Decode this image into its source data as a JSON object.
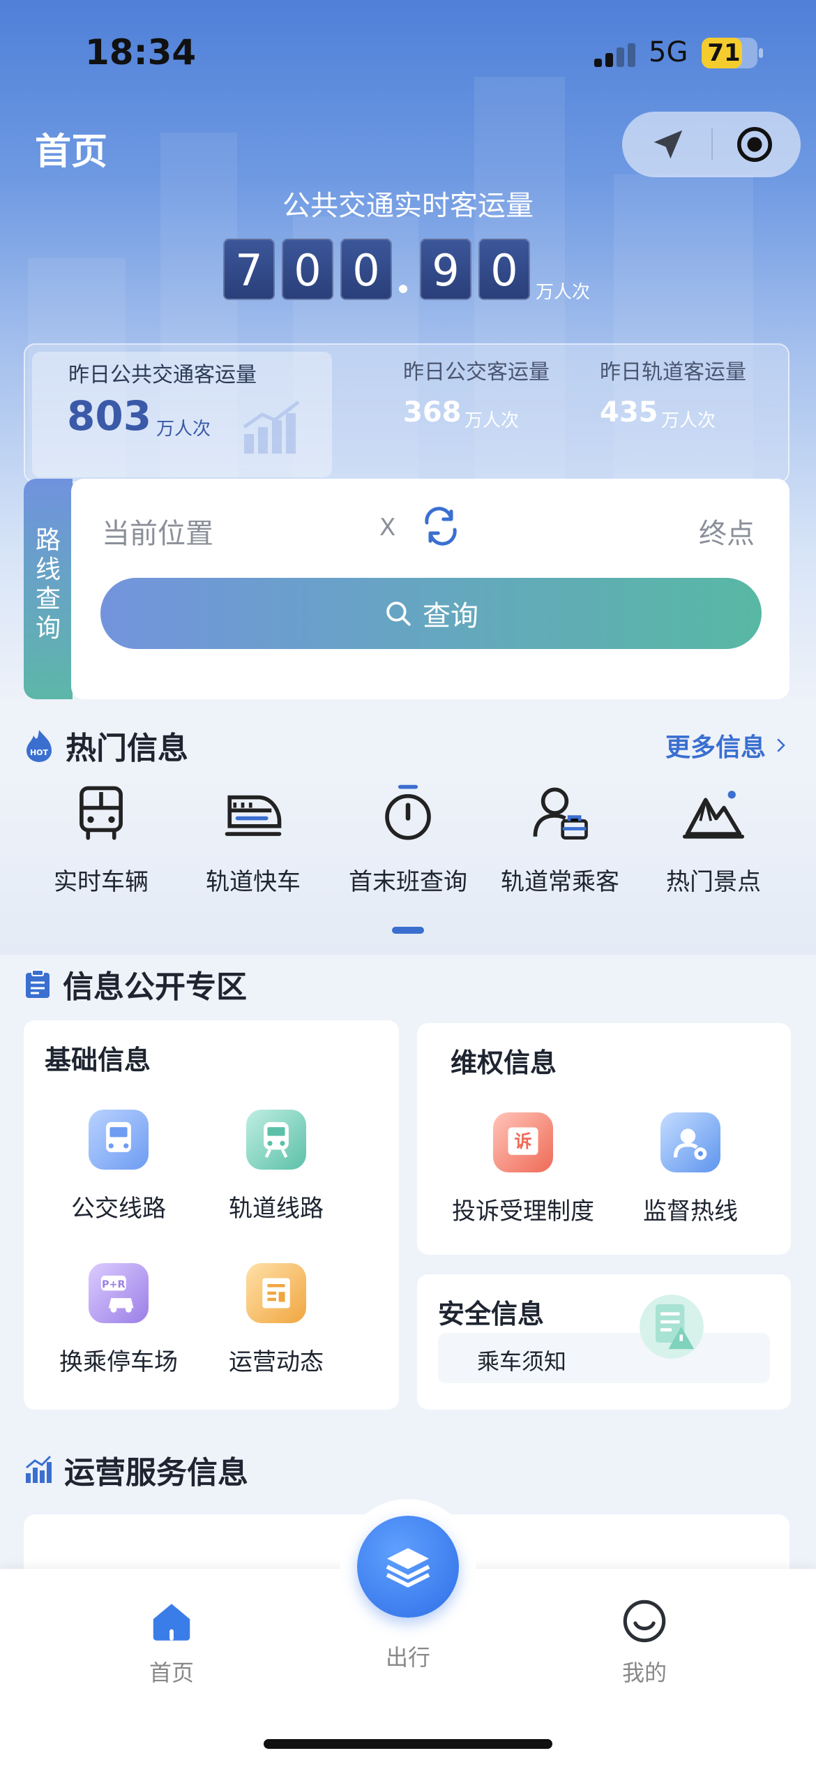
{
  "status_bar": {
    "time": "18:34",
    "network": "5G",
    "battery": "71"
  },
  "header": {
    "title": "首页"
  },
  "ridership": {
    "title": "公共交通实时客运量",
    "digits": [
      "7",
      "0",
      "0",
      "9",
      "0"
    ],
    "unit": "万人次"
  },
  "stats": {
    "main": {
      "label": "昨日公共交通客运量",
      "value": "803",
      "unit": "万人次"
    },
    "bus": {
      "label": "昨日公交客运量",
      "value": "368",
      "unit": "万人次"
    },
    "rail": {
      "label": "昨日轨道客运量",
      "value": "435",
      "unit": "万人次"
    }
  },
  "route": {
    "side_label": "路线查询",
    "from_placeholder": "当前位置",
    "clear": "X",
    "to_placeholder": "终点",
    "query_label": "查询"
  },
  "hot": {
    "title": "热门信息",
    "more": "更多信息",
    "badge": "HOT",
    "items": [
      {
        "label": "实时车辆",
        "icon": "bus-icon"
      },
      {
        "label": "轨道快车",
        "icon": "train-icon"
      },
      {
        "label": "首末班查询",
        "icon": "timer-icon"
      },
      {
        "label": "轨道常乘客",
        "icon": "commuter-icon"
      },
      {
        "label": "热门景点",
        "icon": "mountain-icon"
      }
    ]
  },
  "info": {
    "title": "信息公开专区",
    "basic": {
      "title": "基础信息",
      "items": [
        {
          "label": "公交线路",
          "icon": "bus-route-icon"
        },
        {
          "label": "轨道线路",
          "icon": "rail-route-icon"
        },
        {
          "label": "换乘停车场",
          "icon": "park-ride-icon",
          "badge": "P+R"
        },
        {
          "label": "运营动态",
          "icon": "news-icon"
        }
      ]
    },
    "rights": {
      "title": "维权信息",
      "items": [
        {
          "label": "投诉受理制度",
          "icon": "complaint-icon",
          "badge": "诉"
        },
        {
          "label": "监督热线",
          "icon": "hotline-icon"
        }
      ]
    },
    "safety": {
      "title": "安全信息",
      "item": "乘车须知"
    }
  },
  "ops": {
    "title": "运营服务信息"
  },
  "tabbar": {
    "home": "首页",
    "travel": "出行",
    "mine": "我的"
  },
  "colors": {
    "accent": "#3a6fd0",
    "gradient_start": "#7394dd",
    "gradient_end": "#58b8a3",
    "hero": "#4f80d8"
  }
}
